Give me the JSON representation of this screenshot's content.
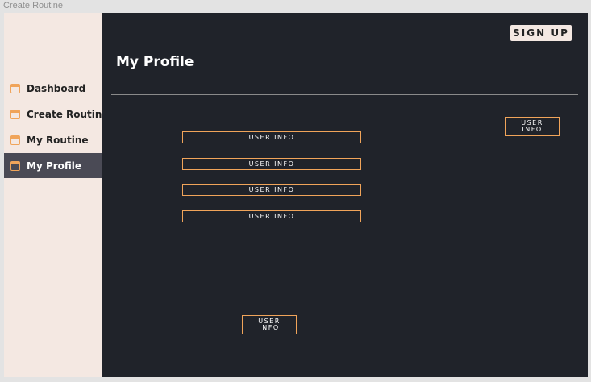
{
  "window": {
    "title": "Create Routine"
  },
  "sidebar": {
    "items": [
      {
        "label": "Dashboard",
        "active": false
      },
      {
        "label": "Create Routine",
        "active": false
      },
      {
        "label": "My Routine",
        "active": false
      },
      {
        "label": "My Profile",
        "active": true
      }
    ]
  },
  "header": {
    "signup_label": "SIGN UP"
  },
  "main": {
    "title": "My Profile",
    "info_fields": [
      "USER INFO",
      "USER INFO",
      "USER INFO",
      "USER INFO"
    ],
    "side_button_label": "USER INFO",
    "bottom_button_label": "USER INFO"
  },
  "colors": {
    "sidebar_bg": "#f4e8e2",
    "main_bg": "#20232a",
    "active_item_bg": "#4a4a55",
    "accent": "#f0a45a"
  },
  "icons": {
    "nav_item_icon": "calendar-icon"
  }
}
